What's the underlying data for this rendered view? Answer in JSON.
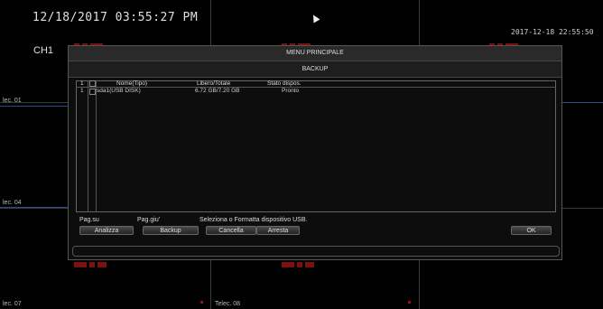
{
  "osd": {
    "datetime": "12/18/2017 03:55:27 PM",
    "datetime_right": "2017-12-18 22:55:50",
    "channel": "CH1",
    "cam_labels": [
      "lec. 01",
      "lec. 04",
      "lec. 07",
      "Telec. 08"
    ]
  },
  "menu": {
    "title": "MENU PRINCIPALE",
    "subtitle": "BACKUP"
  },
  "table": {
    "headers": {
      "index": "1",
      "name": "Nome(Tipo)",
      "free": "Libero/Totale",
      "status": "Stato dispos."
    },
    "rows": [
      {
        "index": "1",
        "name": "sda1(USB DISK)",
        "free": "6.72 GB/7.20 GB",
        "status": "Pronto"
      }
    ]
  },
  "footer": {
    "page_up": "Pag.su",
    "page_down": "Pag.giu'",
    "hint": "Seleziona o Formatta dispositivo USB."
  },
  "buttons": {
    "analyze": "Analizza",
    "backup": "Backup",
    "delete": "Cancella",
    "stop": "Arresta",
    "ok": "OK"
  },
  "colors": {
    "background": "#000000",
    "grid": "#3a3a3a",
    "blue_line": "#2c4a8a",
    "logo_red": "#7a1010"
  }
}
